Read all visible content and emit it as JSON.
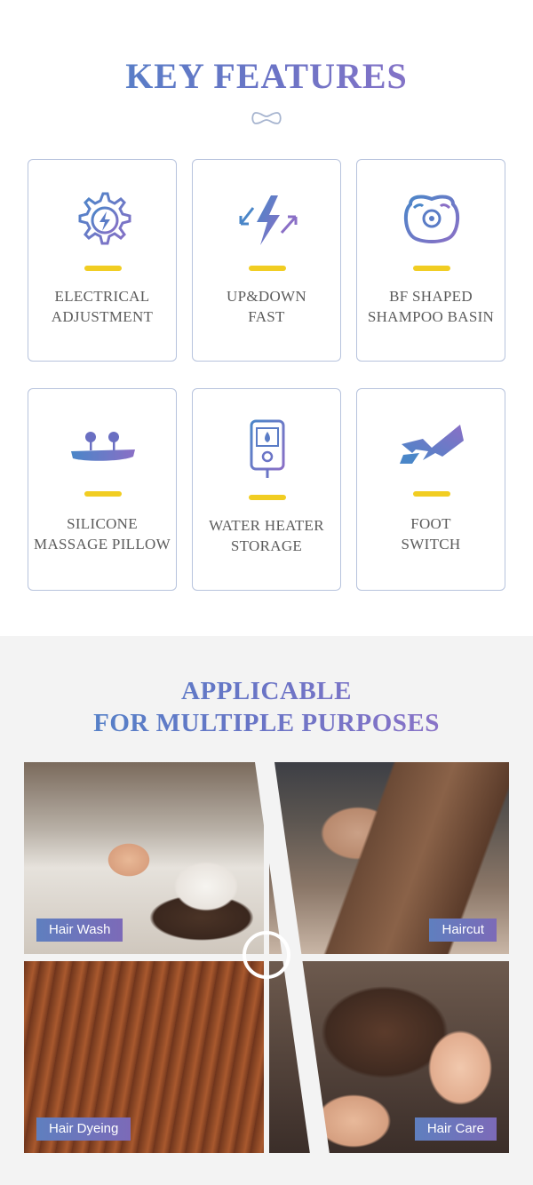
{
  "features": {
    "title": "KEY FEATURES",
    "items": [
      {
        "line1": "ELECTRICAL",
        "line2": "ADJUSTMENT",
        "icon": "gear-lightning-icon"
      },
      {
        "line1": "UP&DOWN",
        "line2": "FAST",
        "icon": "lightning-arrows-icon"
      },
      {
        "line1": "BF SHAPED",
        "line2": "SHAMPOO BASIN",
        "icon": "shampoo-basin-icon"
      },
      {
        "line1": "SILICONE",
        "line2": "MASSAGE PILLOW",
        "icon": "massage-pillow-icon"
      },
      {
        "line1": "WATER HEATER",
        "line2": "STORAGE",
        "icon": "water-heater-icon"
      },
      {
        "line1": "FOOT",
        "line2": "SWITCH",
        "icon": "foot-switch-icon"
      }
    ],
    "colors": {
      "accent_blue": "#4a86c8",
      "accent_purple": "#9a72c8",
      "bar_yellow": "#f1cd22"
    }
  },
  "purposes": {
    "title_line1": "APPLICABLE",
    "title_line2": "FOR MULTIPLE PURPOSES",
    "photos": [
      {
        "label": "Hair Wash"
      },
      {
        "label": "Haircut"
      },
      {
        "label": "Hair Dyeing"
      },
      {
        "label": "Hair Care"
      }
    ]
  }
}
